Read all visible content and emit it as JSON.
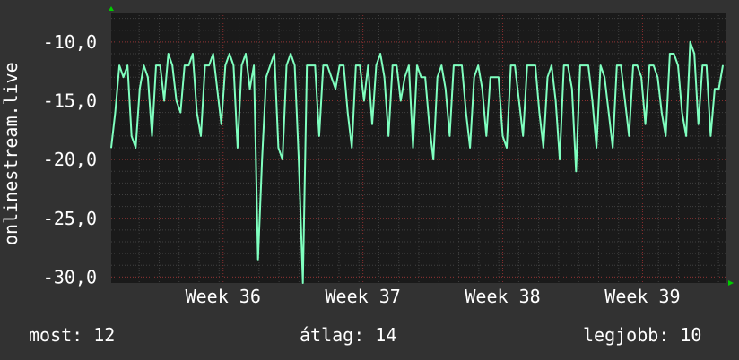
{
  "chart_data": {
    "type": "line",
    "ylabel": "onlinestream.live",
    "xlabel": "",
    "title": "",
    "ylim": [
      -30.5,
      -7.5
    ],
    "y_ticks": [
      "-10,0",
      "-15,0",
      "-20,0",
      "-25,0",
      "-30,0"
    ],
    "y_tick_values": [
      -10,
      -15,
      -20,
      -25,
      -30
    ],
    "x_ticks": [
      "Week 36",
      "Week 37",
      "Week 38",
      "Week 39"
    ],
    "x_tick_values": [
      36,
      37,
      38,
      39
    ],
    "xlim": [
      35.2,
      39.6
    ],
    "grid": true,
    "colors": {
      "background": "#323232",
      "plot": "#1a1a1a",
      "line": "#7fffbf",
      "grid_major": "#8b2e2e",
      "grid_minor": "#404040",
      "arrow": "#00cc00"
    },
    "series": [
      {
        "values": [
          -19,
          -16,
          -12,
          -13,
          -12,
          -18,
          -19,
          -14,
          -12,
          -13,
          -18,
          -12,
          -12,
          -15,
          -11,
          -12,
          -15,
          -16,
          -12,
          -12,
          -11,
          -16,
          -18,
          -12,
          -12,
          -11,
          -14,
          -17,
          -12,
          -11,
          -12,
          -19,
          -12,
          -11,
          -14,
          -12,
          -28.5,
          -20,
          -13,
          -12,
          -11,
          -19,
          -20,
          -12,
          -11,
          -12,
          -20,
          -30.5,
          -12,
          -12,
          -12,
          -18,
          -12,
          -12,
          -13,
          -14,
          -12,
          -12,
          -16,
          -19,
          -12,
          -12,
          -15,
          -12,
          -17,
          -12,
          -11,
          -13,
          -18,
          -12,
          -12,
          -15,
          -13,
          -12,
          -19,
          -12,
          -13,
          -13,
          -17,
          -20,
          -13,
          -12,
          -14,
          -18,
          -12,
          -12,
          -12,
          -16,
          -19,
          -13,
          -12,
          -14,
          -18,
          -13,
          -13,
          -13,
          -18,
          -19,
          -12,
          -12,
          -15,
          -18,
          -12,
          -12,
          -12,
          -16,
          -19,
          -13,
          -12,
          -15,
          -20,
          -12,
          -12,
          -14,
          -21,
          -12,
          -12,
          -12,
          -15,
          -19,
          -12,
          -13,
          -16,
          -19,
          -12,
          -12,
          -15,
          -18,
          -12,
          -12,
          -13,
          -17,
          -12,
          -12,
          -13,
          -16,
          -18,
          -11,
          -11,
          -12,
          -16,
          -18,
          -10,
          -11,
          -17,
          -12,
          -12,
          -18,
          -14,
          -14,
          -12
        ]
      }
    ]
  },
  "stats": {
    "current": "most: 12",
    "average": "átlag: 14",
    "best": "legjobb: 10"
  }
}
